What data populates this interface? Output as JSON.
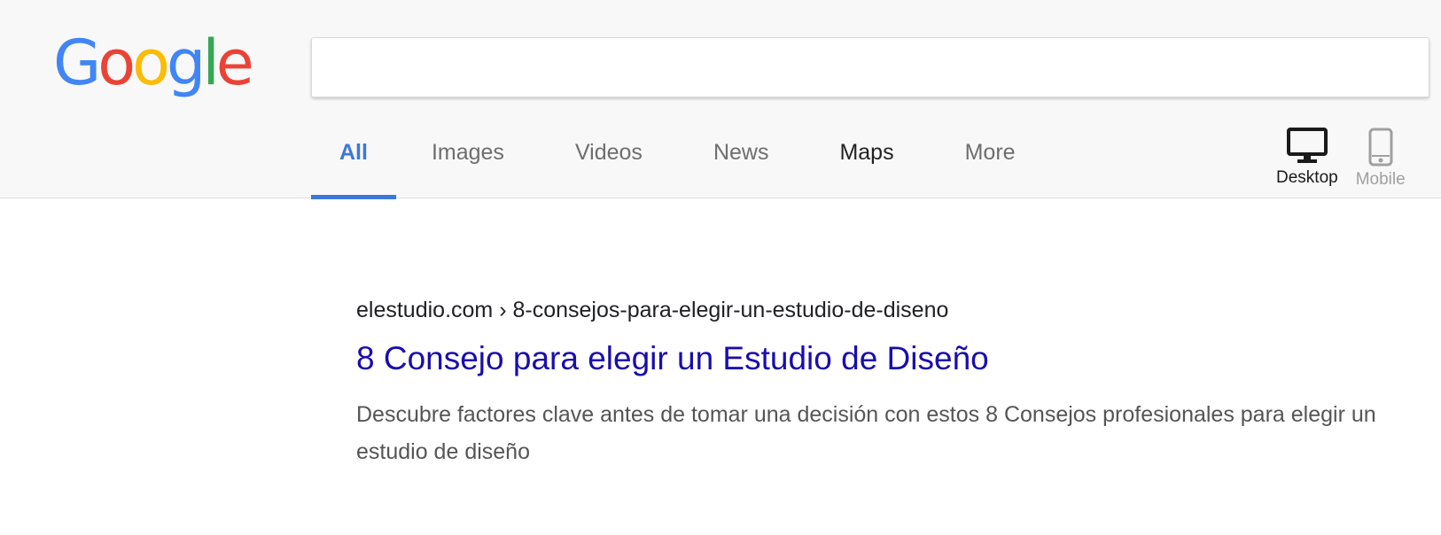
{
  "logo": {
    "letters": [
      "G",
      "o",
      "o",
      "g",
      "l",
      "e"
    ]
  },
  "colors": {
    "logo_blue": "#4285f4",
    "logo_red": "#ea4335",
    "logo_yellow": "#fbbc05",
    "logo_green": "#34a853",
    "accent": "#3c78d8",
    "link": "#1a0dab"
  },
  "search": {
    "value": "",
    "placeholder": ""
  },
  "tabs": [
    {
      "label": "All",
      "active": true
    },
    {
      "label": "Images"
    },
    {
      "label": "Videos"
    },
    {
      "label": "News"
    },
    {
      "label": "Maps"
    },
    {
      "label": "More"
    }
  ],
  "devices": [
    {
      "label": "Desktop",
      "icon": "desktop-icon",
      "selected": true
    },
    {
      "label": "Mobile",
      "icon": "mobile-icon",
      "selected": false
    }
  ],
  "result": {
    "url": "elestudio.com › 8-consejos-para-elegir-un-estudio-de-diseno",
    "title": "8 Consejo para elegir un Estudio de Diseño",
    "snippet": "Descubre factores clave antes de tomar una decisión con estos 8 Consejos profesionales para elegir un estudio de diseño"
  }
}
